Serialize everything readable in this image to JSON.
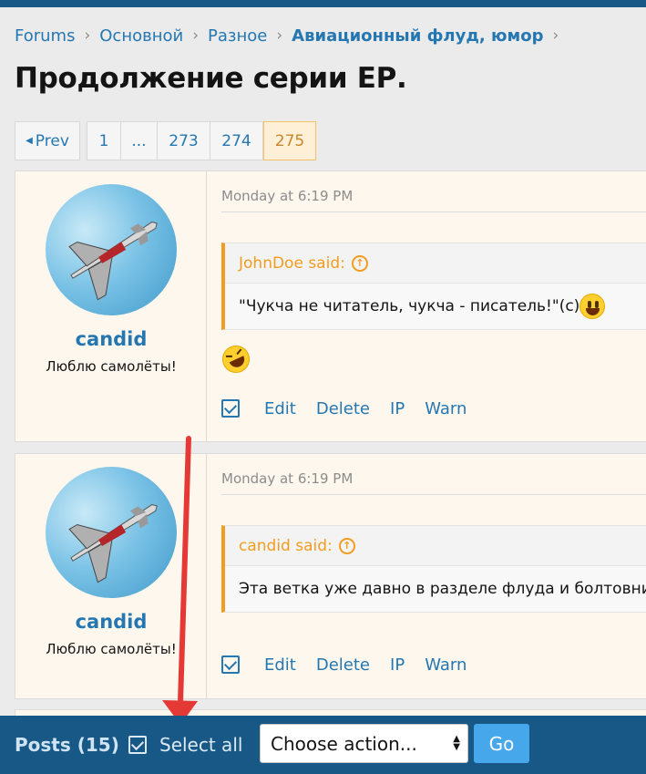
{
  "breadcrumb": {
    "items": [
      "Forums",
      "Основной",
      "Разное"
    ],
    "current": "Авиационный флуд, юмор"
  },
  "thread": {
    "title": "Продолжение серии ЕР."
  },
  "pagination": {
    "prev": "Prev",
    "pages": [
      "1",
      "...",
      "273",
      "274",
      "275"
    ],
    "current": "275"
  },
  "posts": [
    {
      "username": "candid",
      "user_title": "Люблю самолёты!",
      "date": "Monday at 6:19 PM",
      "quote_author": "JohnDoe said:",
      "quote_text": "\"Чукча не читатель, чукча - писатель!\"(c)",
      "body_emoji": "rofl-emoji",
      "actions": [
        "Edit",
        "Delete",
        "IP",
        "Warn"
      ]
    },
    {
      "username": "candid",
      "user_title": "Люблю самолёты!",
      "date": "Monday at 6:19 PM",
      "quote_author": "candid said:",
      "quote_text": "Эта ветка уже давно в разделе флуда и болтовни",
      "actions": [
        "Edit",
        "Delete",
        "IP",
        "Warn"
      ]
    }
  ],
  "bottom_bar": {
    "posts_label": "Posts (15)",
    "select_all": "Select all",
    "action_select": "Choose action...",
    "go": "Go"
  },
  "colors": {
    "link": "#2577b1",
    "header": "#185886",
    "quote_accent": "#f39c1f",
    "post_bg": "#fef7ed",
    "annotation_arrow": "#e53935"
  }
}
